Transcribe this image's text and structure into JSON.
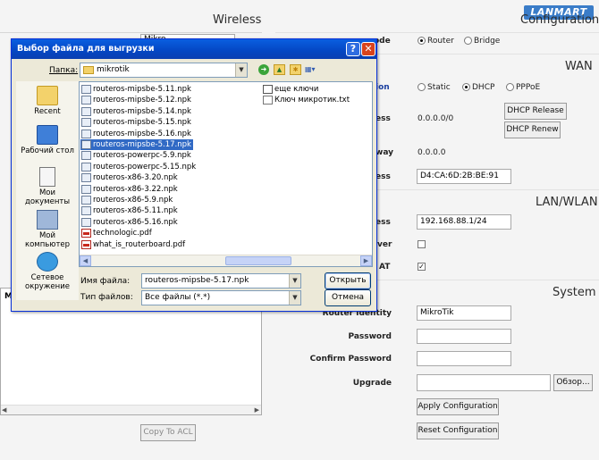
{
  "brand": {
    "logo_text": "LANMART"
  },
  "sections": {
    "wireless": "Wireless",
    "configuration": "Configuration",
    "wan": "WAN",
    "lan_wlan": "LAN/WLAN",
    "system": "System"
  },
  "mode": {
    "label_partial": "ode",
    "options": [
      "Router",
      "Bridge"
    ],
    "selected": "Router"
  },
  "wan": {
    "connection_label_partial": "ion",
    "connection_options": [
      "Static",
      "DHCP",
      "PPPoE"
    ],
    "connection_selected": "DHCP",
    "address_label_partial": "ess",
    "address_value": "0.0.0.0/0",
    "dhcp_release": "DHCP Release",
    "dhcp_renew": "DHCP Renew",
    "gateway_label_partial": "way",
    "gateway_value": "0.0.0.0",
    "mac_label_partial": "ess",
    "mac_value": "D4:CA:6D:2B:BE:91"
  },
  "lan": {
    "address_label_partial": "ess",
    "address_value": "192.168.88.1/24",
    "dhcp_server_label_partial": "ver",
    "nat_label_partial": "AT"
  },
  "system": {
    "identity_label": "Router Identity",
    "identity_value": "MikroTik",
    "password_label": "Password",
    "confirm_label": "Confirm Password",
    "upgrade_label": "Upgrade",
    "browse_label": "Обзор...",
    "apply_label": "Apply Configuration",
    "reset_label": "Reset Configuration"
  },
  "left_panel": {
    "partial_col": "Mi",
    "copy_acl": "Copy To ACL",
    "top_input_partial": "Mikro"
  },
  "dialog": {
    "title": "Выбор файла для выгрузки",
    "folder_label": "Папка:",
    "folder_value": "mikrotik",
    "places": [
      "Recent",
      "Рабочий стол",
      "Мои документы",
      "Мой компьютер",
      "Сетевое окружение"
    ],
    "files_col1": [
      "routeros-mipsbe-5.11.npk",
      "routeros-mipsbe-5.12.npk",
      "routeros-mipsbe-5.14.npk",
      "routeros-mipsbe-5.15.npk",
      "routeros-mipsbe-5.16.npk",
      "routeros-mipsbe-5.17.npk",
      "routeros-powerpc-5.9.npk",
      "routeros-powerpc-5.15.npk",
      "routeros-x86-3.20.npk",
      "routeros-x86-3.22.npk",
      "routeros-x86-5.9.npk",
      "routeros-x86-5.11.npk",
      "routeros-x86-5.16.npk",
      "technologic.pdf",
      "what_is_routerboard.pdf"
    ],
    "files_col2": [
      "еще ключи",
      "Ключ микротик.txt"
    ],
    "selected_file": "routeros-mipsbe-5.17.npk",
    "filename_label": "Имя файла:",
    "filename_value": "routeros-mipsbe-5.17.npk",
    "filetype_label": "Тип файлов:",
    "filetype_value": "Все файлы (*.*)",
    "open_label": "Открыть",
    "cancel_label": "Отмена"
  }
}
